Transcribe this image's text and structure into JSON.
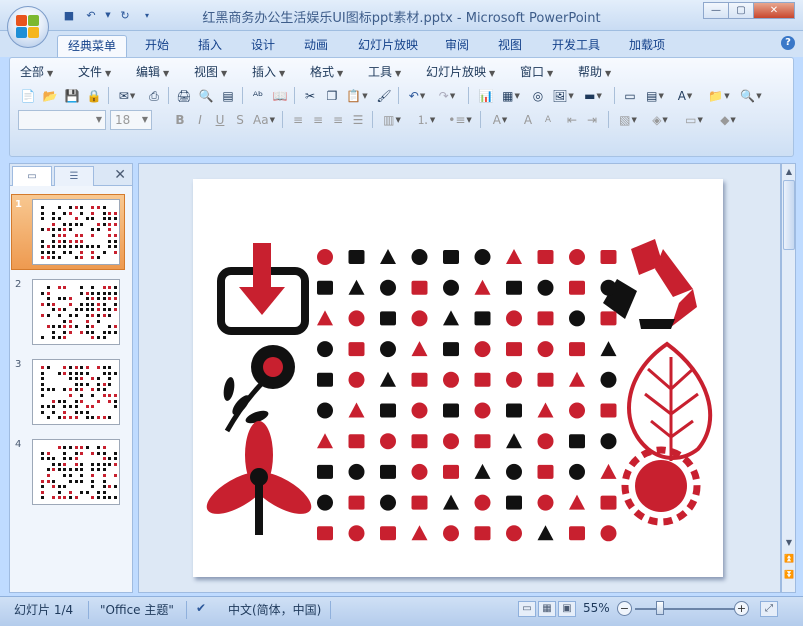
{
  "window": {
    "title": "红黑商务办公生活娱乐UI图标ppt素材.pptx - Microsoft PowerPoint"
  },
  "tabs": [
    "经典菜单",
    "开始",
    "插入",
    "设计",
    "动画",
    "幻灯片放映",
    "审阅",
    "视图",
    "开发工具",
    "加载项"
  ],
  "menus": [
    "全部",
    "文件",
    "编辑",
    "视图",
    "插入",
    "格式",
    "工具",
    "幻灯片放映",
    "窗口",
    "帮助"
  ],
  "format": {
    "font_size": "18"
  },
  "slides": {
    "numbers": [
      "1",
      "2",
      "3",
      "4"
    ]
  },
  "status": {
    "slide": "幻灯片 1/4",
    "theme": "\"Office 主题\"",
    "language": "中文(简体，中国)",
    "zoom": "55%"
  },
  "colors": {
    "accent_red": "#c8202f",
    "icon_black": "#111111",
    "selection_orange": "#f0a15b"
  }
}
